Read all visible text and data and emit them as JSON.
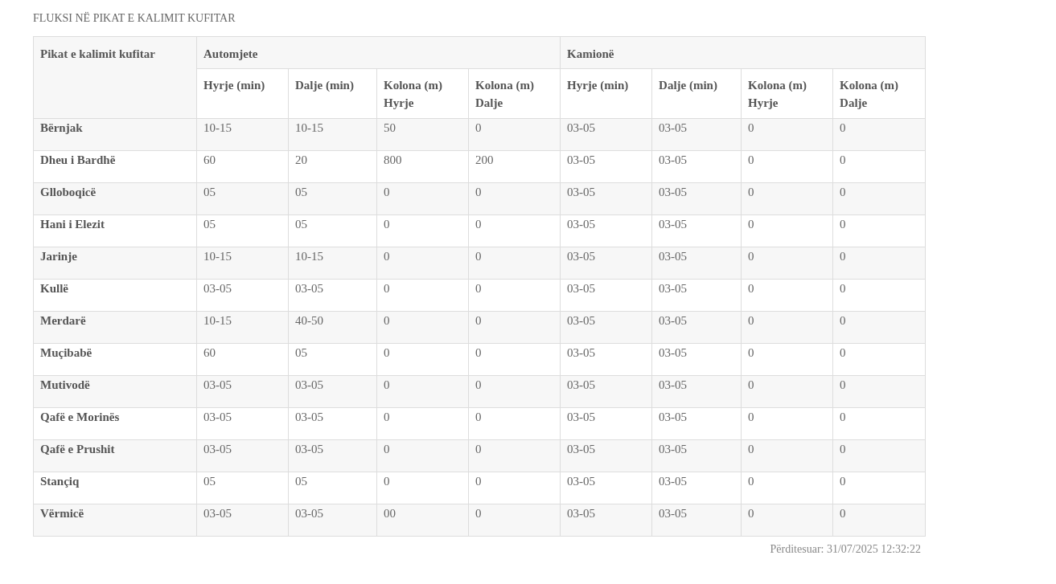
{
  "title": "FLUKSI NË PIKAT E KALIMIT KUFITAR",
  "table": {
    "first_column": "Pikat e kalimit kufitar",
    "groups": [
      {
        "label": "Automjete",
        "columns": [
          {
            "line1": "Hyrje (min)"
          },
          {
            "line1": "Dalje (min)"
          },
          {
            "line1": "Kolona (m)",
            "line2": "Hyrje"
          },
          {
            "line1": "Kolona (m)",
            "line2": "Dalje"
          }
        ]
      },
      {
        "label": "Kamionë",
        "columns": [
          {
            "line1": "Hyrje (min)"
          },
          {
            "line1": "Dalje (min)"
          },
          {
            "line1": "Kolona (m)",
            "line2": "Hyrje"
          },
          {
            "line1": "Kolona (m)",
            "line2": "Dalje"
          }
        ]
      }
    ],
    "rows": [
      {
        "name": "Bërnjak",
        "values": [
          "10-15",
          "10-15",
          "50",
          "0",
          "03-05",
          "03-05",
          "0",
          "0"
        ]
      },
      {
        "name": "Dheu i Bardhë",
        "values": [
          "60",
          "20",
          "800",
          "200",
          "03-05",
          "03-05",
          "0",
          "0"
        ]
      },
      {
        "name": "Glloboqicë",
        "values": [
          "05",
          "05",
          "0",
          "0",
          "03-05",
          "03-05",
          "0",
          "0"
        ]
      },
      {
        "name": "Hani i Elezit",
        "values": [
          "05",
          "05",
          "0",
          "0",
          "03-05",
          "03-05",
          "0",
          "0"
        ]
      },
      {
        "name": "Jarinje",
        "values": [
          "10-15",
          "10-15",
          "0",
          "0",
          "03-05",
          "03-05",
          "0",
          "0"
        ]
      },
      {
        "name": "Kullë",
        "values": [
          "03-05",
          "03-05",
          "0",
          "0",
          "03-05",
          "03-05",
          "0",
          "0"
        ]
      },
      {
        "name": "Merdarë",
        "values": [
          "10-15",
          "40-50",
          "0",
          "0",
          "03-05",
          "03-05",
          "0",
          "0"
        ]
      },
      {
        "name": "Muçibabë",
        "values": [
          "60",
          "05",
          "0",
          "0",
          "03-05",
          "03-05",
          "0",
          "0"
        ]
      },
      {
        "name": "Mutivodë",
        "values": [
          "03-05",
          "03-05",
          "0",
          "0",
          "03-05",
          "03-05",
          "0",
          "0"
        ]
      },
      {
        "name": "Qafë e Morinës",
        "values": [
          "03-05",
          "03-05",
          "0",
          "0",
          "03-05",
          "03-05",
          "0",
          "0"
        ]
      },
      {
        "name": "Qafë e Prushit",
        "values": [
          "03-05",
          "03-05",
          "0",
          "0",
          "03-05",
          "03-05",
          "0",
          "0"
        ]
      },
      {
        "name": "Stançiq",
        "values": [
          "05",
          "05",
          "0",
          "0",
          "03-05",
          "03-05",
          "0",
          "0"
        ]
      },
      {
        "name": "Vërmicë",
        "values": [
          "03-05",
          "03-05",
          "00",
          "0",
          "03-05",
          "03-05",
          "0",
          "0"
        ]
      }
    ]
  },
  "updated": "Përditesuar: 31/07/2025 12:32:22"
}
